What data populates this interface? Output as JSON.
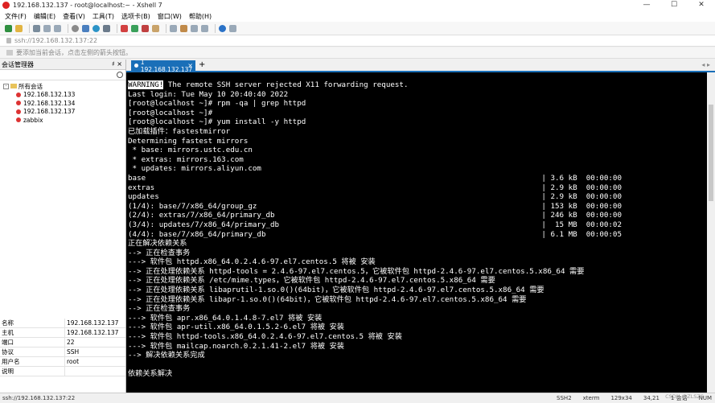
{
  "window": {
    "title": "192.168.132.137 - root@localhost:~ - Xshell 7"
  },
  "window_controls": {
    "minimize": "—",
    "maximize": "☐",
    "close": "✕"
  },
  "menu": [
    "文件(F)",
    "编辑(E)",
    "查看(V)",
    "工具(T)",
    "选项卡(B)",
    "窗口(W)",
    "帮助(H)"
  ],
  "address": "ssh://192.168.132.137:22",
  "hint": "要添加当前会话，点击左侧的箭头按钮。",
  "session_manager": {
    "title": "会话管理器",
    "pin": "♯",
    "close": "×",
    "root_label": "所有会话",
    "sessions": [
      "192.168.132.133",
      "192.168.132.134",
      "192.168.132.137",
      "zabbix"
    ]
  },
  "properties": [
    {
      "k": "名称",
      "v": "192.168.132.137"
    },
    {
      "k": "主机",
      "v": "192.168.132.137"
    },
    {
      "k": "端口",
      "v": "22"
    },
    {
      "k": "协议",
      "v": "SSH"
    },
    {
      "k": "用户名",
      "v": "root"
    },
    {
      "k": "说明",
      "v": ""
    }
  ],
  "tab": {
    "label": "1 192.168.132.137",
    "close": "×",
    "add": "+",
    "nav": "◂ ▸"
  },
  "terminal": {
    "warning_tag": "WARNING!",
    "warning_rest": " The remote SSH server rejected X11 forwarding request.",
    "lines": [
      "Last login: Tue May 10 20:40:40 2022",
      "[root@localhost ~]# rpm -qa | grep httpd",
      "[root@localhost ~]#",
      "[root@localhost ~]# yum install -y httpd",
      "已加载插件：fastestmirror",
      "Determining fastest mirrors",
      " * base: mirrors.ustc.edu.cn",
      " * extras: mirrors.163.com",
      " * updates: mirrors.aliyun.com",
      "base                                                                                         | 3.6 kB  00:00:00",
      "extras                                                                                       | 2.9 kB  00:00:00",
      "updates                                                                                      | 2.9 kB  00:00:00",
      "(1/4): base/7/x86_64/group_gz                                                                | 153 kB  00:00:00",
      "(2/4): extras/7/x86_64/primary_db                                                            | 246 kB  00:00:00",
      "(3/4): updates/7/x86_64/primary_db                                                           |  15 MB  00:00:02",
      "(4/4): base/7/x86_64/primary_db                                                              | 6.1 MB  00:00:05",
      "正在解决依赖关系",
      "--> 正在检查事务",
      "---> 软件包 httpd.x86_64.0.2.4.6-97.el7.centos.5 将被 安装",
      "--> 正在处理依赖关系 httpd-tools = 2.4.6-97.el7.centos.5，它被软件包 httpd-2.4.6-97.el7.centos.5.x86_64 需要",
      "--> 正在处理依赖关系 /etc/mime.types，它被软件包 httpd-2.4.6-97.el7.centos.5.x86_64 需要",
      "--> 正在处理依赖关系 libaprutil-1.so.0()(64bit)，它被软件包 httpd-2.4.6-97.el7.centos.5.x86_64 需要",
      "--> 正在处理依赖关系 libapr-1.so.0()(64bit)，它被软件包 httpd-2.4.6-97.el7.centos.5.x86_64 需要",
      "--> 正在检查事务",
      "---> 软件包 apr.x86_64.0.1.4.8-7.el7 将被 安装",
      "---> 软件包 apr-util.x86_64.0.1.5.2-6.el7 将被 安装",
      "---> 软件包 httpd-tools.x86_64.0.2.4.6-97.el7.centos.5 将被 安装",
      "---> 软件包 mailcap.noarch.0.2.1.41-2.el7 将被 安装",
      "--> 解决依赖关系完成",
      "",
      "依赖关系解决"
    ]
  },
  "status": {
    "address": "ssh://192.168.132.137:22",
    "protocol": "SSH2",
    "term": "xterm",
    "size": "129x34",
    "pos": "34,21",
    "sessions": "1 会话",
    "caps": "NUM"
  },
  "watermark": "CSDN @ZLSZS"
}
